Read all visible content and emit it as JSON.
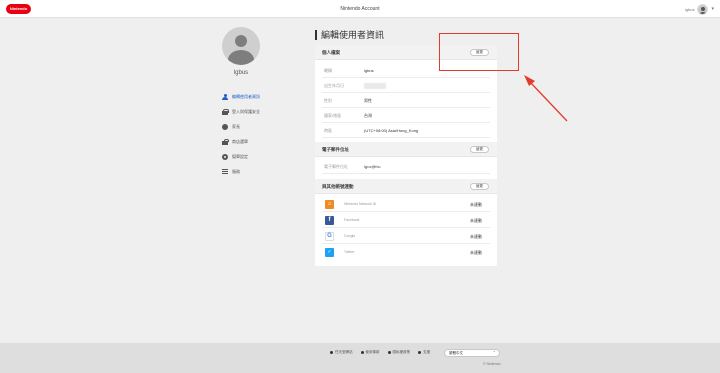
{
  "header": {
    "logo_text": "Nintendo",
    "title": "Nintendo Account",
    "user_name": "lgbus",
    "menu_chevron": "▾"
  },
  "sidebar": {
    "username": "lgbus",
    "items": [
      {
        "label": "編輯使用者資訊",
        "icon": "person-icon",
        "active": true
      },
      {
        "label": "登入與保護安全",
        "icon": "lock-icon",
        "active": false
      },
      {
        "label": "家長",
        "icon": "kids-icon",
        "active": false
      },
      {
        "label": "商店選單",
        "icon": "shop-icon",
        "active": false
      },
      {
        "label": "擬單設定",
        "icon": "gear-icon",
        "active": false
      },
      {
        "label": "服務",
        "icon": "list-icon",
        "active": false
      }
    ]
  },
  "main": {
    "title": "編輯使用者資訊",
    "profile": {
      "title": "個人檔案",
      "edit_label": "變更",
      "rows": [
        {
          "label": "暱稱",
          "value": "lgbus"
        },
        {
          "label": "出生年月日",
          "value": ""
        },
        {
          "label": "性別",
          "value": "男性"
        },
        {
          "label": "國家/地區",
          "value": "台灣"
        },
        {
          "label": "時區",
          "value": "(UTC+08:00) Asia/Hong_Kong"
        }
      ]
    },
    "email": {
      "title": "電子郵件位址",
      "edit_label": "變更",
      "rows": [
        {
          "label": "電子郵件位址",
          "value": "lg•••@f•••"
        }
      ]
    },
    "linked": {
      "title": "與其他帳號連動",
      "edit_label": "變更",
      "services": [
        {
          "name": "Nintendo Network ID",
          "status": "未連動",
          "icon": "nintendo-network-icon",
          "glyph": "⌂",
          "color": "#f08a24"
        },
        {
          "name": "Facebook",
          "status": "未連動",
          "icon": "facebook-icon",
          "glyph": "f",
          "color": "#3b5998"
        },
        {
          "name": "Google",
          "status": "未連動",
          "icon": "google-icon",
          "glyph": "G",
          "color": "#ffffff"
        },
        {
          "name": "Twitter",
          "status": "未連動",
          "icon": "twitter-icon",
          "glyph": "✓",
          "color": "#1da1f2"
        }
      ]
    }
  },
  "footer": {
    "links": [
      "任天堂網站",
      "使用條款",
      "隱私權政策",
      "支援"
    ],
    "language": "繁體中文",
    "language_arrow": "⌃",
    "copyright": "© Nintendo"
  },
  "colors": {
    "accent": "#1a5fc9",
    "brand": "#e60012",
    "annotation": "#e53b2c"
  }
}
